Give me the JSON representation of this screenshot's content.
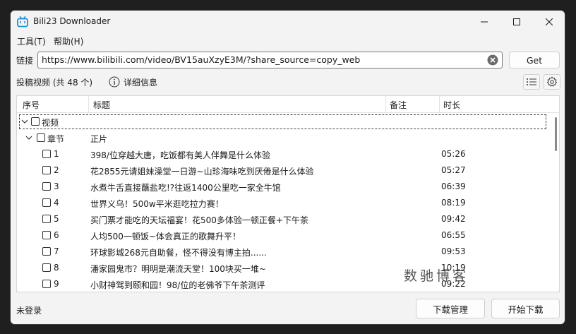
{
  "window": {
    "title": "Bili23 Downloader"
  },
  "menu": {
    "tools": "工具(T)",
    "help": "帮助(H)"
  },
  "url": {
    "label": "链接",
    "value": "https://www.bilibili.com/video/BV15auXzyE3M/?share_source=copy_web",
    "get_label": "Get"
  },
  "info": {
    "count_text": "投稿视频 (共 48 个)",
    "detail_label": "详细信息"
  },
  "table": {
    "headers": {
      "index": "序号",
      "title": "标题",
      "note": "备注",
      "duration": "时长"
    },
    "tree": {
      "root": "视频",
      "chapter": "章节",
      "chapter_title": "正片"
    },
    "rows": [
      {
        "index": "1",
        "title": "398/位穿越大唐，吃饭都有美人伴舞是什么体验",
        "duration": "05:26"
      },
      {
        "index": "2",
        "title": "花2855元请姐妹澡堂一日游~山珍海味吃到厌倦是什么体验",
        "duration": "05:27"
      },
      {
        "index": "3",
        "title": "水煮牛舌直接蘸盐吃!?往返1400公里吃一家全牛馆",
        "duration": "06:39"
      },
      {
        "index": "4",
        "title": "世界义乌！500w平米逛吃拉力赛！",
        "duration": "08:19"
      },
      {
        "index": "5",
        "title": "买门票才能吃的天坛福宴！花500多体验一顿正餐+下午茶",
        "duration": "09:42"
      },
      {
        "index": "6",
        "title": "人均500一顿饭~体会真正的歌舞升平！",
        "duration": "06:55"
      },
      {
        "index": "7",
        "title": "环球影城268元自助餐，怪不得没有博主拍......",
        "duration": "09:53"
      },
      {
        "index": "8",
        "title": "潘家园鬼市？明明是潮流天堂！100块买一堆~",
        "duration": "10:19"
      },
      {
        "index": "9",
        "title": "小财神驾到颐和园！98/位的老佛爷下午茶测评",
        "duration": "09:22"
      }
    ]
  },
  "status": {
    "login": "未登录",
    "download_manager": "下载管理",
    "start_download": "开始下载"
  },
  "watermark": "数驰博客",
  "colors": {
    "app_icon": "#1e8fd8",
    "clear_icon": "#6b6b6b"
  }
}
